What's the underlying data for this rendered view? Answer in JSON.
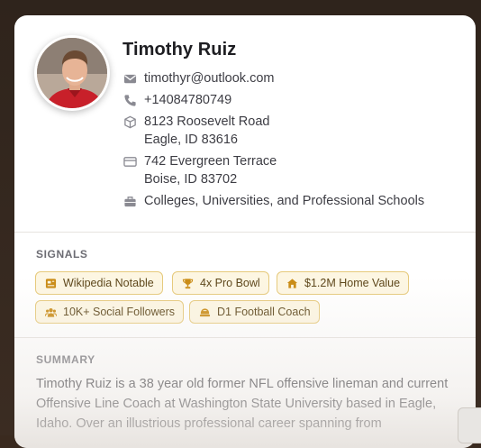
{
  "profile": {
    "name": "Timothy Ruiz",
    "email": "timothyr@outlook.com",
    "phone": "+14084780749",
    "address1": {
      "line1": "8123 Roosevelt Road",
      "line2": "Eagle, ID 83616"
    },
    "address2": {
      "line1": "742 Evergreen Terrace",
      "line2": "Boise, ID 83702"
    },
    "industry": "Colleges, Universities, and Professional Schools"
  },
  "signals": {
    "title": "SIGNALS",
    "chips": [
      {
        "label": "Wikipedia Notable",
        "icon": "wikipedia-icon"
      },
      {
        "label": "4x Pro Bowl",
        "icon": "trophy-icon"
      },
      {
        "label": "$1.2M Home Value",
        "icon": "home-icon"
      },
      {
        "label": "10K+ Social Followers",
        "icon": "followers-icon"
      },
      {
        "label": "D1 Football Coach",
        "icon": "football-icon"
      }
    ]
  },
  "summary": {
    "title": "SUMMARY",
    "text": "Timothy Ruiz is a 38 year old former NFL offensive lineman and current Offensive Line Coach at Washington State University based in Eagle, Idaho. Over an illustrious professional career spanning from"
  },
  "colors": {
    "chip_border": "#e6c97a",
    "chip_bg": "#fdf6e2",
    "chip_icon": "#c98a12",
    "icon_gray": "#8a8a92"
  }
}
